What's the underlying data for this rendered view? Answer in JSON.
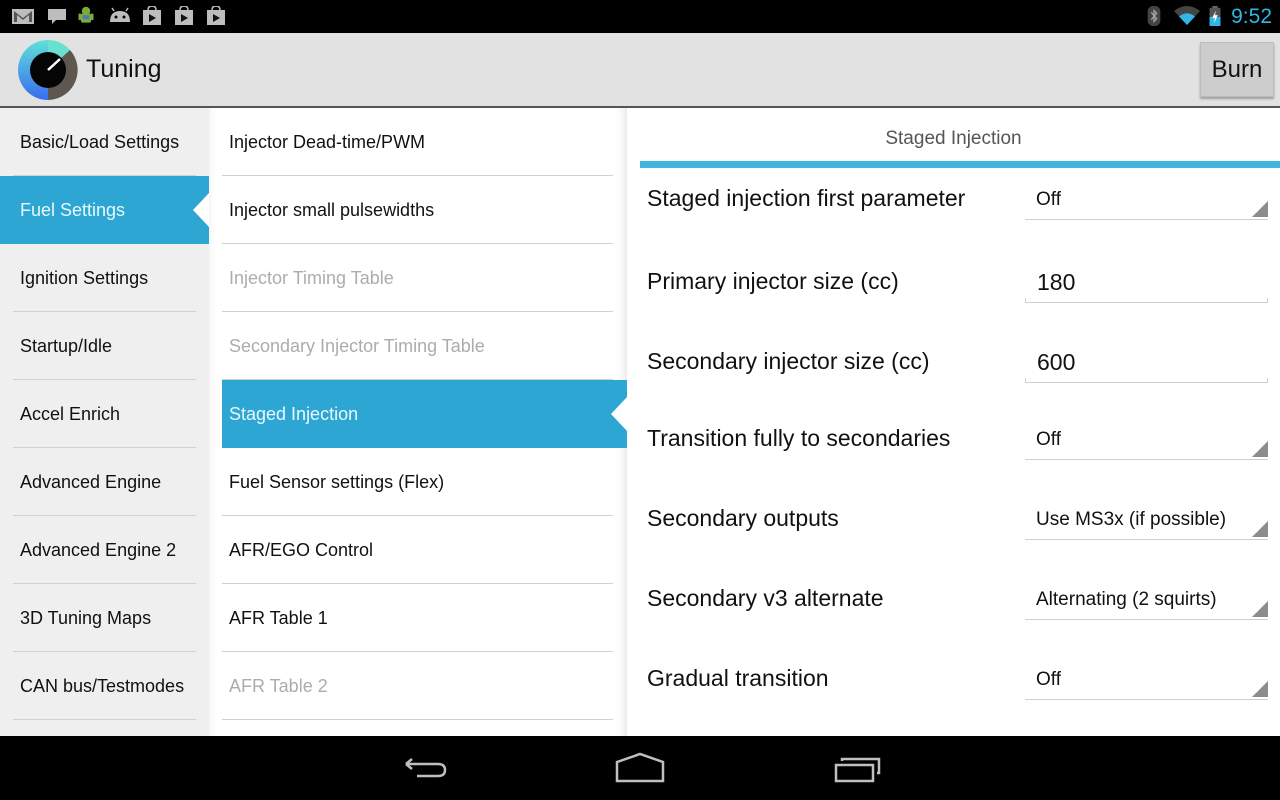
{
  "status_bar": {
    "notification_icons": [
      "gmail-icon",
      "message-icon",
      "android-debug-icon",
      "android-icon",
      "play-store-icon",
      "play-store-icon",
      "play-store-icon"
    ],
    "system_icons": [
      "bluetooth-icon",
      "wifi-icon",
      "battery-charging-icon"
    ],
    "time": "9:52"
  },
  "action_bar": {
    "title": "Tuning",
    "burn_label": "Burn"
  },
  "categories": [
    {
      "label": "Basic/Load Settings",
      "active": false
    },
    {
      "label": "Fuel Settings",
      "active": true
    },
    {
      "label": "Ignition Settings",
      "active": false
    },
    {
      "label": "Startup/Idle",
      "active": false
    },
    {
      "label": "Accel Enrich",
      "active": false
    },
    {
      "label": "Advanced Engine",
      "active": false
    },
    {
      "label": "Advanced Engine 2",
      "active": false
    },
    {
      "label": "3D Tuning Maps",
      "active": false
    },
    {
      "label": "CAN bus/Testmodes",
      "active": false
    }
  ],
  "subitems": [
    {
      "label": "Injector Dead-time/PWM",
      "state": "enabled"
    },
    {
      "label": "Injector small pulsewidths",
      "state": "enabled"
    },
    {
      "label": "Injector Timing Table",
      "state": "disabled"
    },
    {
      "label": "Secondary Injector Timing Table",
      "state": "disabled"
    },
    {
      "label": "Staged Injection",
      "state": "active"
    },
    {
      "label": "Fuel Sensor settings (Flex)",
      "state": "enabled"
    },
    {
      "label": "AFR/EGO Control",
      "state": "enabled"
    },
    {
      "label": "AFR Table 1",
      "state": "enabled"
    },
    {
      "label": "AFR Table 2",
      "state": "disabled"
    }
  ],
  "panel": {
    "title": "Staged Injection",
    "fields": [
      {
        "label": "Staged injection first parameter",
        "type": "spinner",
        "value": "Off"
      },
      {
        "label": "Primary injector size (cc)",
        "type": "text",
        "value": "180"
      },
      {
        "label": "Secondary injector size (cc)",
        "type": "text",
        "value": "600"
      },
      {
        "label": "Transition fully to secondaries",
        "type": "spinner",
        "value": "Off"
      },
      {
        "label": "Secondary outputs",
        "type": "spinner",
        "value": "Use MS3x (if possible)"
      },
      {
        "label": "Secondary v3 alternate",
        "type": "spinner",
        "value": "Alternating (2 squirts)"
      },
      {
        "label": "Gradual transition",
        "type": "spinner",
        "value": "Off"
      }
    ]
  },
  "nav_bar": {
    "buttons": [
      "back-icon",
      "home-icon",
      "recent-apps-icon"
    ]
  },
  "colors": {
    "accent": "#2ea6d4",
    "panel_bar": "#3fb5df",
    "clock": "#33b5e5"
  }
}
